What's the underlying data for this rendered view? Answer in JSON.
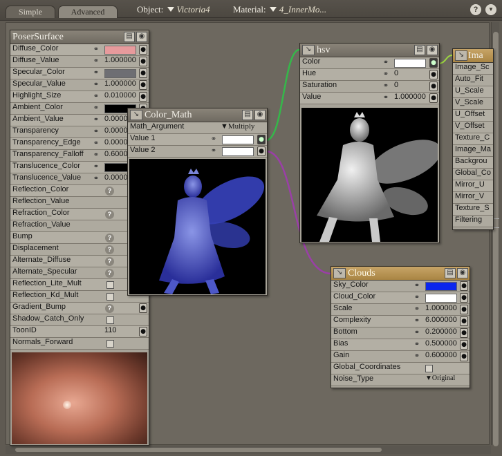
{
  "tabs": {
    "simple": "Simple",
    "advanced": "Advanced"
  },
  "toolbar": {
    "object_label": "Object:",
    "object_value": "Victoria4",
    "material_label": "Material:",
    "material_value": "4_InnerMo...",
    "help_label": "?"
  },
  "poser": {
    "title": "PoserSurface",
    "rows": [
      {
        "label": "Diffuse_Color",
        "kind": "color",
        "color": "#e79a9c"
      },
      {
        "label": "Diffuse_Value",
        "kind": "num",
        "value": "1.000000"
      },
      {
        "label": "Specular_Color",
        "kind": "color",
        "color": "#6e6e73"
      },
      {
        "label": "Specular_Value",
        "kind": "num",
        "value": "1.000000"
      },
      {
        "label": "Highlight_Size",
        "kind": "num",
        "value": "0.010000"
      },
      {
        "label": "Ambient_Color",
        "kind": "color",
        "color": "#000000"
      },
      {
        "label": "Ambient_Value",
        "kind": "num",
        "value": "0.0000"
      },
      {
        "label": "Transparency",
        "kind": "num",
        "value": "0.0000"
      },
      {
        "label": "Transparency_Edge",
        "kind": "num",
        "value": "0.0000"
      },
      {
        "label": "Transparency_Falloff",
        "kind": "num",
        "value": "0.6000"
      },
      {
        "label": "Translucence_Color",
        "kind": "color",
        "color": "#000000"
      },
      {
        "label": "Translucence_Value",
        "kind": "num",
        "value": "0.0000"
      },
      {
        "label": "Reflection_Color",
        "kind": "q"
      },
      {
        "label": "Reflection_Value",
        "kind": "none"
      },
      {
        "label": "Refraction_Color",
        "kind": "q"
      },
      {
        "label": "Refraction_Value",
        "kind": "none"
      },
      {
        "label": "Bump",
        "kind": "q"
      },
      {
        "label": "Displacement",
        "kind": "q"
      },
      {
        "label": "Alternate_Diffuse",
        "kind": "q"
      },
      {
        "label": "Alternate_Specular",
        "kind": "q"
      },
      {
        "label": "Reflection_Lite_Mult",
        "kind": "check"
      },
      {
        "label": "Reflection_Kd_Mult",
        "kind": "check"
      },
      {
        "label": "Gradient_Bump",
        "kind": "q"
      },
      {
        "label": "Shadow_Catch_Only",
        "kind": "check"
      },
      {
        "label": "ToonID",
        "kind": "int",
        "value": "110"
      },
      {
        "label": "Normals_Forward",
        "kind": "check"
      }
    ]
  },
  "colormath": {
    "title": "Color_Math",
    "argument_label": "Math_Argument",
    "argument_value": "Multiply",
    "value1_label": "Value 1",
    "value2_label": "Value 2"
  },
  "hsv": {
    "title": "hsv",
    "color_label": "Color",
    "hue_label": "Hue",
    "hue_value": "0",
    "saturation_label": "Saturation",
    "saturation_value": "0",
    "value_label": "Value",
    "value_value": "1.000000"
  },
  "image": {
    "title": "Ima",
    "rows": [
      "Image_Sc",
      "Auto_Fit",
      "U_Scale",
      "V_Scale",
      "U_Offset",
      "V_Offset",
      "Texture_C",
      "Image_Ma",
      "Backgrou",
      "Global_Co",
      "Mirror_U",
      "Mirror_V",
      "Texture_S",
      "Filtering"
    ]
  },
  "clouds": {
    "title": "Clouds",
    "sky_color_label": "Sky_Color",
    "sky_color": "#0a26ee",
    "cloud_color_label": "Cloud_Color",
    "cloud_color": "#ffffff",
    "scale_label": "Scale",
    "scale_value": "1.000000",
    "complexity_label": "Complexity",
    "complexity_value": "6.000000",
    "bottom_label": "Bottom",
    "bottom_value": "0.200000",
    "bias_label": "Bias",
    "bias_value": "0.500000",
    "gain_label": "Gain",
    "gain_value": "0.600000",
    "global_label": "Global_Coordinates",
    "noise_label": "Noise_Type",
    "noise_value": "Original"
  },
  "colors": {
    "wire_green": "#35b84a",
    "wire_purple": "#9a3fa7",
    "accent_gold": "#b8944f"
  }
}
